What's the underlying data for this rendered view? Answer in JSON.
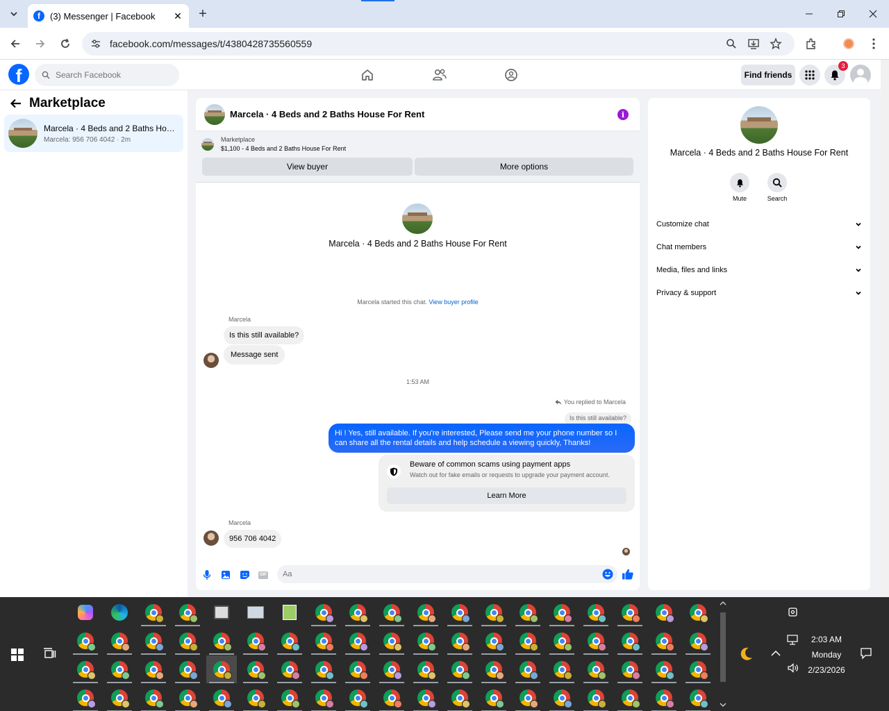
{
  "browser": {
    "tab_title": "(3) Messenger | Facebook",
    "url": "facebook.com/messages/t/4380428735560559"
  },
  "fb": {
    "search_placeholder": "Search Facebook",
    "find_friends": "Find friends",
    "notif_count": "3"
  },
  "sidebar": {
    "title": "Marketplace",
    "conversation": {
      "name": "Marcela · 4 Beds and 2 Baths Hous...",
      "preview": "Marcela: 956 706 4042 · 2m"
    }
  },
  "chat": {
    "title": "Marcela · 4 Beds and 2 Baths House For Rent",
    "marketplace_label": "Marketplace",
    "listing": "$1,100 - 4 Beds and 2 Baths House For Rent",
    "view_buyer": "View buyer",
    "more_options": "More options",
    "started_text": "Marcela started this chat.",
    "view_buyer_profile": "View buyer profile",
    "sender_name": "Marcela",
    "msg1": "Is this still available?",
    "msg2": "Message sent",
    "timestamp": "1:53 AM",
    "replied_to": "You replied to Marcela",
    "quoted": "Is this still available?",
    "reply": "Hi ! Yes, still available. If you're interested, Please send me your phone number so I can share all the rental details and help schedule a viewing quickly, Thanks!",
    "scam_title": "Beware of common scams using payment apps",
    "scam_sub": "Watch out for fake emails or requests to upgrade your payment account.",
    "learn_more": "Learn More",
    "msg3": "956 706 4042",
    "composer_placeholder": "Aa"
  },
  "details": {
    "title": "Marcela · 4 Beds and 2 Baths House For Rent",
    "mute": "Mute",
    "search": "Search",
    "rows": [
      "Customize chat",
      "Chat members",
      "Media, files and links",
      "Privacy & support"
    ]
  },
  "taskbar": {
    "time": "2:03 AM",
    "day": "Monday",
    "date": "2/23/2026"
  },
  "colors": {
    "fb_blue": "#0866ff",
    "info_purple": "#9b19d6",
    "taskbar": "#2b2b2b"
  }
}
